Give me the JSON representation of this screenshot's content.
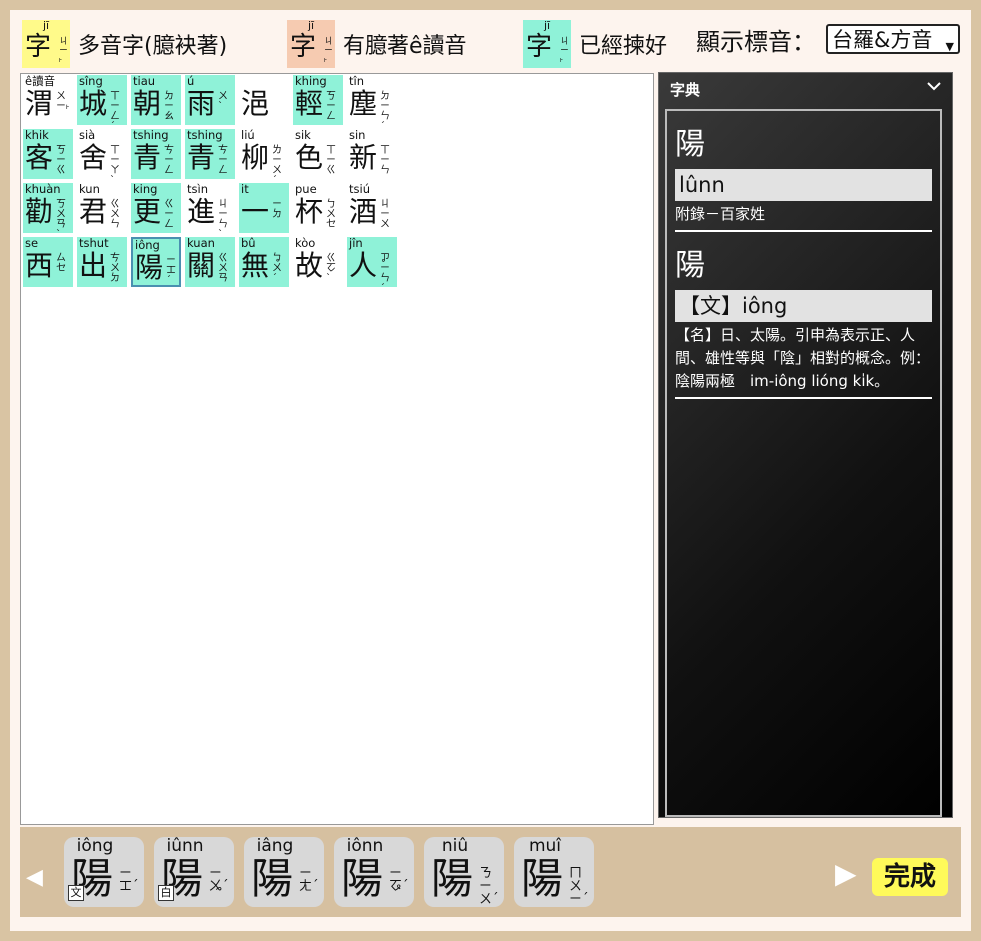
{
  "legend": [
    {
      "romanization": "jī",
      "char": "字",
      "zhuyin": "ㄐㄧ˫",
      "label": "多音字(臆袂著)",
      "color": "#fffa8a"
    },
    {
      "romanization": "jī",
      "char": "字",
      "zhuyin": "ㄐㄧ˫",
      "label": "有臆著ê讀音",
      "color": "#f6cbb1"
    },
    {
      "romanization": "jī",
      "char": "字",
      "zhuyin": "ㄐㄧ˫",
      "label": "已經揀好",
      "color": "#8ff2d8"
    }
  ],
  "display": {
    "label": "顯示標音：",
    "value": "台羅&方音"
  },
  "text_grid": [
    {
      "rom": "ê讀音",
      "char": "渭",
      "zy": "ㄨㄧ˫",
      "green": false
    },
    {
      "rom": "sîng",
      "char": "城",
      "zy": "ㄒㄧㄥˊ",
      "green": true
    },
    {
      "rom": "tiau",
      "char": "朝",
      "zy": "ㄉㄧㄠ",
      "green": true
    },
    {
      "rom": "ú",
      "char": "雨",
      "zy": "ㄨˋ",
      "green": true
    },
    {
      "rom": "",
      "char": "浥",
      "zy": "",
      "green": false
    },
    {
      "rom": "khing",
      "char": "輕",
      "zy": "ㄎㄧㄥ",
      "green": true
    },
    {
      "rom": "tîn",
      "char": "塵",
      "zy": "ㄉㄧㄣˊ",
      "green": false
    },
    {
      "rom": "khik",
      "char": "客",
      "zy": "ㄎㄧㄍ",
      "green": true
    },
    {
      "rom": "sià",
      "char": "舍",
      "zy": "ㄒㄧㄚˋ",
      "green": false
    },
    {
      "rom": "tshing",
      "char": "青",
      "zy": "ㄘㄧㄥ",
      "green": true
    },
    {
      "rom": "tshing",
      "char": "青",
      "zy": "ㄘㄧㄥ",
      "green": true
    },
    {
      "rom": "liú",
      "char": "柳",
      "zy": "ㄌㄧㄨˊ",
      "green": false
    },
    {
      "rom": "sik",
      "char": "色",
      "zy": "ㄒㄧㄍ",
      "green": false
    },
    {
      "rom": "sin",
      "char": "新",
      "zy": "ㄒㄧㄣ",
      "green": false
    },
    {
      "rom": "khuàn",
      "char": "勸",
      "zy": "ㄎㄨㄢˋ",
      "green": true
    },
    {
      "rom": "kun",
      "char": "君",
      "zy": "ㄍㄨㄣ",
      "green": false
    },
    {
      "rom": "king",
      "char": "更",
      "zy": "ㄍㄧㄥ",
      "green": true
    },
    {
      "rom": "tsìn",
      "char": "進",
      "zy": "ㄐㄧㄣˋ",
      "green": false
    },
    {
      "rom": "it",
      "char": "一",
      "zy": "ㄧㄉ",
      "green": true
    },
    {
      "rom": "pue",
      "char": "杯",
      "zy": "ㄅㄨㆤ",
      "green": false
    },
    {
      "rom": "tsiú",
      "char": "酒",
      "zy": "ㄐㄧㄨ",
      "green": false
    },
    {
      "rom": "se",
      "char": "西",
      "zy": "ㄙㆤ",
      "green": true
    },
    {
      "rom": "tshut",
      "char": "出",
      "zy": "ㄘㄨㄉ",
      "green": true
    },
    {
      "rom": "iông",
      "char": "陽",
      "zy": "ㄧㆲˊ",
      "green": true,
      "selected": true
    },
    {
      "rom": "kuan",
      "char": "關",
      "zy": "ㄍㄨㄢ",
      "green": true
    },
    {
      "rom": "bû",
      "char": "無",
      "zy": "ㆠㄨˊ",
      "green": true
    },
    {
      "rom": "kòo",
      "char": "故",
      "zy": "ㄍㆦˋ",
      "green": false
    },
    {
      "rom": "jîn",
      "char": "人",
      "zy": "ㆡㄧㄣˊ",
      "green": true
    }
  ],
  "dictionary": {
    "title": "字典",
    "entries": [
      {
        "char": "陽",
        "reading": "lûnn",
        "note": "附錄－百家姓"
      },
      {
        "char": "陽",
        "reading": "【文】iông",
        "note": "【名】日、太陽。引申為表示正、人間、雄性等與「陰」相對的概念。例：陰陽兩極　im-iông lióng ki̍k。"
      }
    ]
  },
  "candidates": [
    {
      "rom": "iông",
      "char": "陽",
      "zy": "ㄧㆲˊ",
      "tag": "文"
    },
    {
      "rom": "iûnn",
      "char": "陽",
      "zy": "ㄧㆫˊ",
      "tag": "白"
    },
    {
      "rom": "iâng",
      "char": "陽",
      "zy": "ㄧㄤˊ",
      "tag": ""
    },
    {
      "rom": "iônn",
      "char": "陽",
      "zy": "ㄧㆧˊ",
      "tag": ""
    },
    {
      "rom": "niû",
      "char": "陽",
      "zy": "ㄋㄧㄨˊ",
      "tag": ""
    },
    {
      "rom": "muî",
      "char": "陽",
      "zy": "ㄇㄨㄧˊ",
      "tag": ""
    }
  ],
  "done_label": "完成",
  "left_arrow": "◀",
  "right_arrow": "▶"
}
